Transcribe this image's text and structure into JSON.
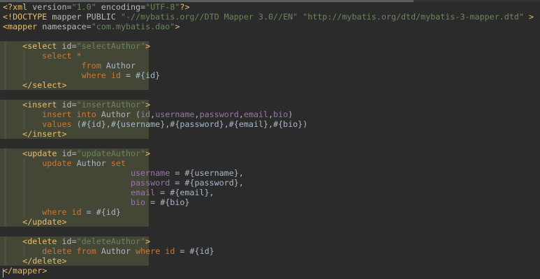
{
  "editor": {
    "language": "XML",
    "lines": [
      {
        "hl": false,
        "tokens": [
          [
            "ang",
            "<?"
          ],
          [
            "tag",
            "xml"
          ],
          [
            "sym",
            " "
          ],
          [
            "attr",
            "version"
          ],
          [
            "sym",
            "="
          ],
          [
            "str",
            "\"1.0\""
          ],
          [
            "sym",
            " "
          ],
          [
            "attr",
            "encoding"
          ],
          [
            "sym",
            "="
          ],
          [
            "str",
            "\"UTF-8\""
          ],
          [
            "ang",
            "?>"
          ]
        ]
      },
      {
        "hl": false,
        "tokens": [
          [
            "ang",
            "<!"
          ],
          [
            "tag",
            "DOCTYPE"
          ],
          [
            "sym",
            " "
          ],
          [
            "attr",
            "mapper PUBLIC "
          ],
          [
            "str",
            "\"-//mybatis.org//DTD Mapper 3.0//EN\""
          ],
          [
            "sym",
            " "
          ],
          [
            "str",
            "\"http://mybatis.org/dtd/mybatis-3-mapper.dtd\""
          ],
          [
            "sym",
            " "
          ],
          [
            "ang",
            ">"
          ]
        ]
      },
      {
        "hl": false,
        "tokens": [
          [
            "ang",
            "<"
          ],
          [
            "tag",
            "mapper"
          ],
          [
            "sym",
            " "
          ],
          [
            "attr",
            "namespace"
          ],
          [
            "sym",
            "="
          ],
          [
            "str",
            "\"com.mybatis.dao\""
          ],
          [
            "ang",
            ">"
          ]
        ]
      },
      {
        "hl": false,
        "tokens": []
      },
      {
        "hl": true,
        "indent": 1,
        "tokens": [
          [
            "sym",
            "    "
          ],
          [
            "ang",
            "<"
          ],
          [
            "tag",
            "select"
          ],
          [
            "sym",
            " "
          ],
          [
            "attr",
            "id"
          ],
          [
            "sym",
            "="
          ],
          [
            "str",
            "\"selectAuthor\""
          ],
          [
            "ang",
            ">"
          ]
        ]
      },
      {
        "hl": true,
        "indent": 2,
        "tokens": [
          [
            "sym",
            "        "
          ],
          [
            "kw",
            "select"
          ],
          [
            "sym",
            " "
          ],
          [
            "kw",
            "*"
          ]
        ]
      },
      {
        "hl": true,
        "indent": 2,
        "tokens": [
          [
            "sym",
            "                "
          ],
          [
            "kw",
            "from"
          ],
          [
            "sym",
            " "
          ],
          [
            "id",
            "Author"
          ]
        ]
      },
      {
        "hl": true,
        "indent": 2,
        "tokens": [
          [
            "sym",
            "                "
          ],
          [
            "kw",
            "where"
          ],
          [
            "sym",
            " "
          ],
          [
            "kw",
            "id"
          ],
          [
            "sym",
            " = #{"
          ],
          [
            "id",
            "id"
          ],
          [
            "sym",
            "}"
          ]
        ]
      },
      {
        "hl": true,
        "indent": 1,
        "tokens": [
          [
            "sym",
            "    "
          ],
          [
            "ang",
            "</"
          ],
          [
            "tag",
            "select"
          ],
          [
            "ang",
            ">"
          ]
        ]
      },
      {
        "hl": false,
        "tokens": []
      },
      {
        "hl": true,
        "indent": 1,
        "tokens": [
          [
            "sym",
            "    "
          ],
          [
            "ang",
            "<"
          ],
          [
            "tag",
            "insert"
          ],
          [
            "sym",
            " "
          ],
          [
            "attr",
            "id"
          ],
          [
            "sym",
            "="
          ],
          [
            "str",
            "\"insertAuthor\""
          ],
          [
            "ang",
            ">"
          ]
        ]
      },
      {
        "hl": true,
        "indent": 2,
        "tokens": [
          [
            "sym",
            "        "
          ],
          [
            "kw",
            "insert"
          ],
          [
            "sym",
            " "
          ],
          [
            "kw",
            "into"
          ],
          [
            "sym",
            " "
          ],
          [
            "id",
            "Author"
          ],
          [
            "sym",
            " ("
          ],
          [
            "var",
            "id"
          ],
          [
            "sym",
            ","
          ],
          [
            "var",
            "username"
          ],
          [
            "sym",
            ","
          ],
          [
            "var",
            "password"
          ],
          [
            "sym",
            ","
          ],
          [
            "var",
            "email"
          ],
          [
            "sym",
            ","
          ],
          [
            "var",
            "bio"
          ],
          [
            "sym",
            ")"
          ]
        ]
      },
      {
        "hl": true,
        "indent": 2,
        "tokens": [
          [
            "sym",
            "        "
          ],
          [
            "kw",
            "values"
          ],
          [
            "sym",
            " (#{"
          ],
          [
            "id",
            "id"
          ],
          [
            "sym",
            "},#{"
          ],
          [
            "id",
            "username"
          ],
          [
            "sym",
            "},#{"
          ],
          [
            "id",
            "password"
          ],
          [
            "sym",
            "},#{"
          ],
          [
            "id",
            "email"
          ],
          [
            "sym",
            "},#{"
          ],
          [
            "id",
            "bio"
          ],
          [
            "sym",
            "})"
          ]
        ]
      },
      {
        "hl": true,
        "indent": 1,
        "tokens": [
          [
            "sym",
            "    "
          ],
          [
            "ang",
            "</"
          ],
          [
            "tag",
            "insert"
          ],
          [
            "ang",
            ">"
          ]
        ]
      },
      {
        "hl": false,
        "tokens": []
      },
      {
        "hl": true,
        "indent": 1,
        "tokens": [
          [
            "sym",
            "    "
          ],
          [
            "ang",
            "<"
          ],
          [
            "tag",
            "update"
          ],
          [
            "sym",
            " "
          ],
          [
            "attr",
            "id"
          ],
          [
            "sym",
            "="
          ],
          [
            "str",
            "\"updateAuthor\""
          ],
          [
            "ang",
            ">"
          ]
        ]
      },
      {
        "hl": true,
        "indent": 2,
        "tokens": [
          [
            "sym",
            "        "
          ],
          [
            "kw",
            "update"
          ],
          [
            "sym",
            " "
          ],
          [
            "id",
            "Author"
          ],
          [
            "sym",
            " "
          ],
          [
            "kw",
            "set"
          ]
        ]
      },
      {
        "hl": true,
        "indent": 2,
        "tokens": [
          [
            "sym",
            "                          "
          ],
          [
            "var",
            "username"
          ],
          [
            "sym",
            " = #{"
          ],
          [
            "id",
            "username"
          ],
          [
            "sym",
            "},"
          ]
        ]
      },
      {
        "hl": true,
        "indent": 2,
        "tokens": [
          [
            "sym",
            "                          "
          ],
          [
            "var",
            "password"
          ],
          [
            "sym",
            " = #{"
          ],
          [
            "id",
            "password"
          ],
          [
            "sym",
            "},"
          ]
        ]
      },
      {
        "hl": true,
        "indent": 2,
        "tokens": [
          [
            "sym",
            "                          "
          ],
          [
            "var",
            "email"
          ],
          [
            "sym",
            " = #{"
          ],
          [
            "id",
            "email"
          ],
          [
            "sym",
            "},"
          ]
        ]
      },
      {
        "hl": true,
        "indent": 2,
        "tokens": [
          [
            "sym",
            "                          "
          ],
          [
            "var",
            "bio"
          ],
          [
            "sym",
            " = #{"
          ],
          [
            "id",
            "bio"
          ],
          [
            "sym",
            "}"
          ]
        ]
      },
      {
        "hl": true,
        "indent": 2,
        "tokens": [
          [
            "sym",
            "        "
          ],
          [
            "kw",
            "where"
          ],
          [
            "sym",
            " "
          ],
          [
            "kw",
            "id"
          ],
          [
            "sym",
            " = #{"
          ],
          [
            "id",
            "id"
          ],
          [
            "sym",
            "}"
          ]
        ]
      },
      {
        "hl": true,
        "indent": 1,
        "tokens": [
          [
            "sym",
            "    "
          ],
          [
            "ang",
            "</"
          ],
          [
            "tag",
            "update"
          ],
          [
            "ang",
            ">"
          ]
        ]
      },
      {
        "hl": false,
        "tokens": []
      },
      {
        "hl": true,
        "indent": 1,
        "tokens": [
          [
            "sym",
            "    "
          ],
          [
            "ang",
            "<"
          ],
          [
            "tag",
            "delete"
          ],
          [
            "sym",
            " "
          ],
          [
            "attr",
            "id"
          ],
          [
            "sym",
            "="
          ],
          [
            "str",
            "\"deleteAuthor\""
          ],
          [
            "ang",
            ">"
          ]
        ]
      },
      {
        "hl": true,
        "indent": 2,
        "tokens": [
          [
            "sym",
            "        "
          ],
          [
            "kw",
            "delete"
          ],
          [
            "sym",
            " "
          ],
          [
            "kw",
            "from"
          ],
          [
            "sym",
            " "
          ],
          [
            "id",
            "Author"
          ],
          [
            "sym",
            " "
          ],
          [
            "kw",
            "where"
          ],
          [
            "sym",
            " "
          ],
          [
            "kw",
            "id"
          ],
          [
            "sym",
            " = #{"
          ],
          [
            "id",
            "id"
          ],
          [
            "sym",
            "}"
          ]
        ]
      },
      {
        "hl": true,
        "indent": 1,
        "tokens": [
          [
            "sym",
            "    "
          ],
          [
            "ang",
            "</"
          ],
          [
            "tag",
            "delete"
          ],
          [
            "ang",
            ">"
          ]
        ]
      },
      {
        "hl": false,
        "tokens": [
          [
            "ang",
            "</"
          ],
          [
            "tag",
            "mapper"
          ],
          [
            "ang",
            ">"
          ]
        ]
      }
    ]
  },
  "colors": {
    "background": "#2b2b2b",
    "highlight": "#444636",
    "tag": "#e8bf6a",
    "attribute": "#bababa",
    "string": "#6a8759",
    "keyword": "#cc7832",
    "identifier": "#a9b7c6",
    "field": "#9876aa"
  }
}
